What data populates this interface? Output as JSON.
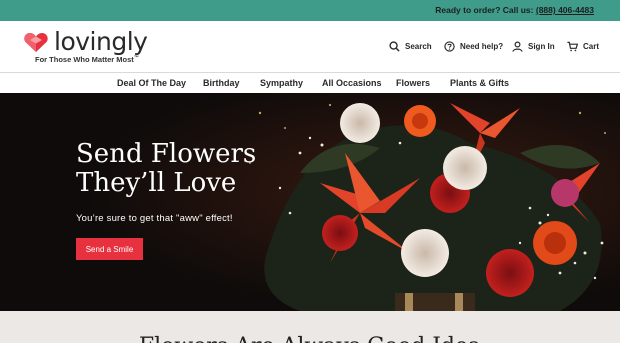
{
  "topbar": {
    "message": "Ready to order? Call us: ",
    "phone": "(888) 406-4483"
  },
  "brand": {
    "name": "lovingly",
    "tagline": "For Those Who Matter Most",
    "tagline_mark": "™"
  },
  "utility": {
    "search": "Search",
    "help": "Need help?",
    "signin": "Sign In",
    "cart": "Cart"
  },
  "nav": {
    "items": [
      "Deal Of The Day",
      "Birthday",
      "Sympathy",
      "All Occasions",
      "Flowers",
      "Plants & Gifts"
    ]
  },
  "hero": {
    "title_line1": "Send Flowers",
    "title_line2": "They’ll Love",
    "subtitle": "You’re sure to get that \"aww\" effect!",
    "button": "Send a Smile"
  },
  "section": {
    "heading": "Flowers Are Always Good Idea"
  },
  "colors": {
    "topbar": "#3f9c8b",
    "accent_red": "#e8313f",
    "hero_bg": "#0e0b0a",
    "footer_band": "#ebe8e6"
  },
  "icons": [
    "search-icon",
    "help-circle-icon",
    "user-icon",
    "cart-icon",
    "heart-box-logo-icon"
  ]
}
